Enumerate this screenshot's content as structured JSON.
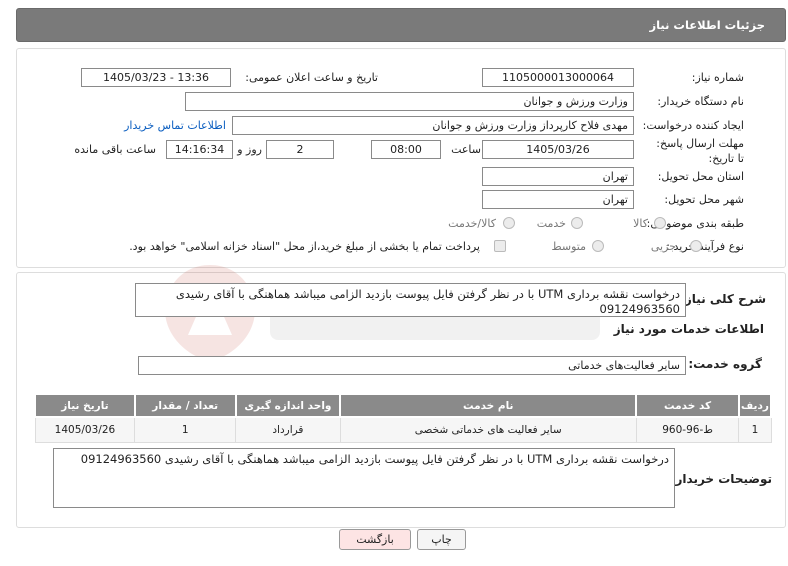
{
  "header": {
    "title": "جزئیات اطلاعات نیاز"
  },
  "fields": {
    "need_number_label": "شماره نیاز:",
    "need_number": "1105000013000064",
    "announce_label": "تاریخ و ساعت اعلان عمومی:",
    "announce_value": "1405/03/23 - 13:36",
    "buyer_org_label": "نام دستگاه خریدار:",
    "buyer_org": "وزارت ورزش و جوانان",
    "creator_label": "ایجاد کننده درخواست:",
    "creator": "مهدی فلاح کارپرداز وزارت ورزش و جوانان",
    "contact_link": "اطلاعات تماس خریدار",
    "deadline_label": "مهلت ارسال پاسخ: تا تاریخ:",
    "deadline_date": "1405/03/26",
    "time_label": "ساعت",
    "deadline_time": "08:00",
    "days_value": "2",
    "days_label": "روز و",
    "remaining_time": "14:16:34",
    "remaining_label": "ساعت باقی مانده",
    "province_label": "استان محل تحویل:",
    "province": "تهران",
    "city_label": "شهر محل تحویل:",
    "city": "تهران",
    "category_label": "طبقه بندی موضوعی:",
    "category_options": [
      "کالا",
      "خدمت",
      "کالا/خدمت"
    ],
    "process_label": "نوع فرآیند خرید :",
    "process_options": [
      "جزیی",
      "متوسط"
    ],
    "payment_note": "پرداخت تمام یا بخشی از مبلغ خرید،از محل \"اسناد خزانه اسلامی\" خواهد بود."
  },
  "summary": {
    "label": "شرح کلی نیاز:",
    "text": "درخواست نقشه برداری UTM با در نظر گرفتن  فایل پیوست بازدید الزامی میباشد هماهنگی با آقای رشیدی 09124963560"
  },
  "services": {
    "title": "اطلاعات خدمات مورد نیاز",
    "group_label": "گروه خدمت:",
    "group_value": "سایر فعالیت‌های خدماتی",
    "columns": [
      "ردیف",
      "کد خدمت",
      "نام خدمت",
      "واحد اندازه گیری",
      "تعداد / مقدار",
      "تاریخ نیاز"
    ],
    "rows": [
      {
        "row": "1",
        "code": "ط-96-960",
        "name": "سایر فعالیت های خدماتی شخصی",
        "unit": "قرارداد",
        "qty": "1",
        "date": "1405/03/26"
      }
    ]
  },
  "buyer_notes": {
    "label": "توضیحات خریدار:",
    "text": "درخواست نقشه برداری UTM با در نظر گرفتن  فایل پیوست بازدید الزامی میباشد هماهنگی با آقای رشیدی 09124963560"
  },
  "buttons": {
    "print": "چاپ",
    "back": "بازگشت"
  },
  "colors": {
    "header_bg": "#7a7a7a",
    "table_header_bg": "#8a8a8a",
    "link": "#0b5ec0",
    "back_button_bg": "#fde4e4"
  }
}
